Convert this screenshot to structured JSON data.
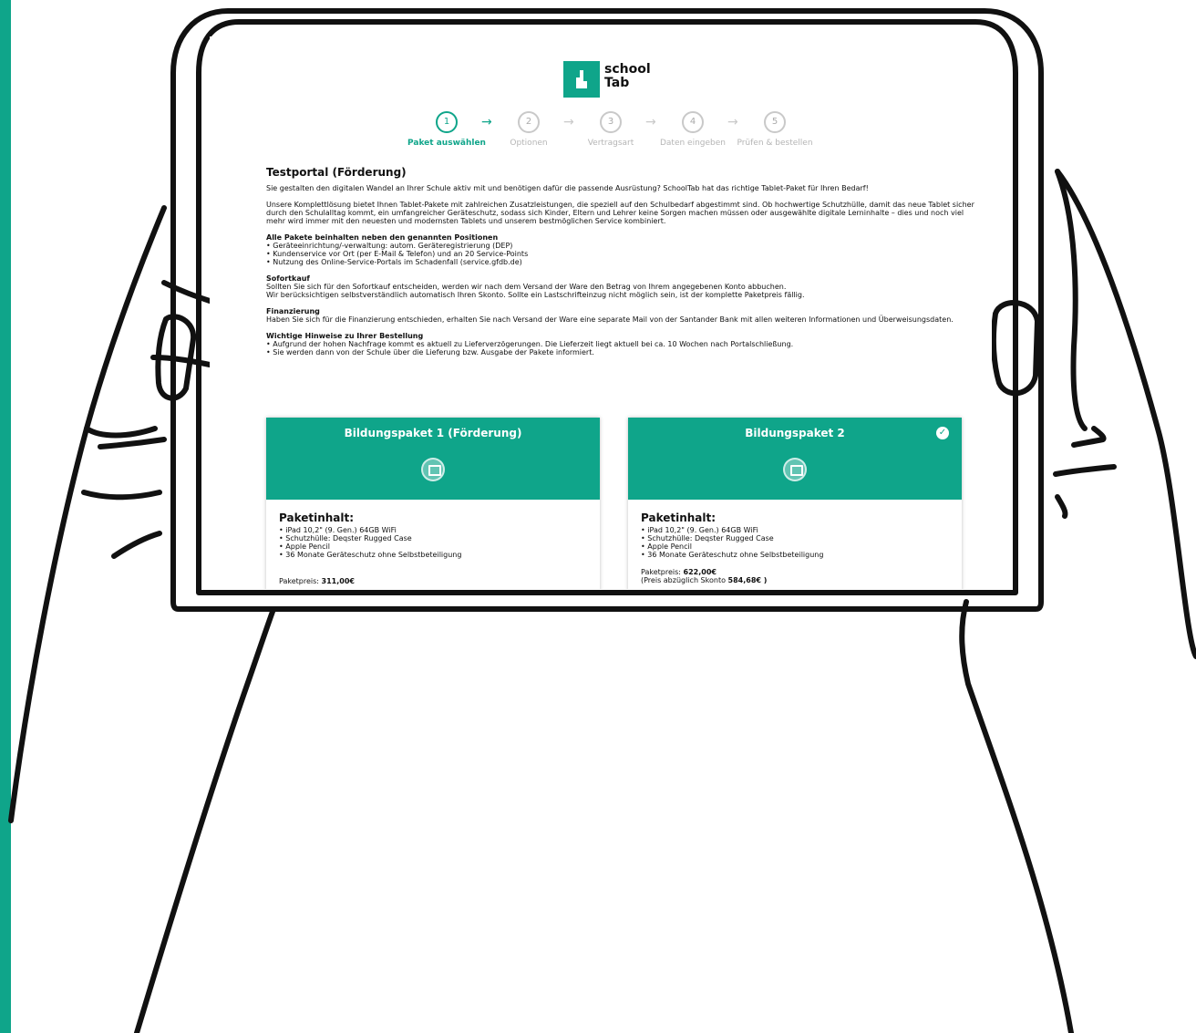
{
  "logo": {
    "line1": "school",
    "line2": "Tab"
  },
  "steps": [
    {
      "num": "1",
      "label": "Paket auswählen",
      "active": true
    },
    {
      "num": "2",
      "label": "Optionen",
      "active": false
    },
    {
      "num": "3",
      "label": "Vertragsart",
      "active": false
    },
    {
      "num": "4",
      "label": "Daten eingeben",
      "active": false
    },
    {
      "num": "5",
      "label": "Prüfen & bestellen",
      "active": false
    }
  ],
  "arrow_glyph": "→",
  "page": {
    "title": "Testportal (Förderung)",
    "intro": "Sie gestalten den digitalen Wandel an Ihrer Schule aktiv mit und benötigen dafür die passende Ausrüstung? SchoolTab hat das richtige Tablet-Paket für Ihren Bedarf!",
    "description": "Unsere Komplettlösung bietet Ihnen Tablet-Pakete mit zahlreichen Zusatzleistungen, die speziell auf den Schulbedarf abgestimmt sind. Ob hochwertige Schutzhülle, damit das neue Tablet sicher durch den Schulalltag kommt, ein umfangreicher Geräteschutz, sodass sich Kinder, Eltern und Lehrer keine Sorgen machen müssen oder ausgewählte digitale Lerninhalte – dies und noch viel mehr wird immer mit den neuesten und modernsten Tablets und unserem bestmöglichen Service kombiniert.",
    "sections": [
      {
        "heading": "Alle Pakete beinhalten neben den genannten Positionen",
        "lines": [
          "• Geräteeinrichtung/-verwaltung: autom. Geräteregistrierung (DEP)",
          "• Kundenservice vor Ort (per E-Mail & Telefon) und an 20 Service-Points",
          "• Nutzung des Online-Service-Portals im Schadenfall (service.gfdb.de)"
        ]
      },
      {
        "heading": "Sofortkauf",
        "lines": [
          "Sollten Sie sich für den Sofortkauf entscheiden, werden wir nach dem Versand der Ware den Betrag von Ihrem angegebenen Konto abbuchen.",
          "Wir berücksichtigen selbstverständlich automatisch Ihren Skonto. Sollte ein Lastschrifteinzug nicht möglich sein, ist der komplette Paketpreis fällig."
        ]
      },
      {
        "heading": "Finanzierung",
        "lines": [
          "Haben Sie sich für die Finanzierung entschieden, erhalten Sie nach Versand der Ware eine separate Mail von der Santander Bank mit allen weiteren Informationen und Überweisungsdaten."
        ]
      },
      {
        "heading": "Wichtige Hinweise zu Ihrer Bestellung",
        "lines": [
          "• Aufgrund der hohen Nachfrage kommt es aktuell zu Lieferverzögerungen. Die Lieferzeit liegt aktuell bei ca. 10 Wochen nach Portalschließung.",
          "• Sie werden dann von der Schule über die Lieferung bzw. Ausgabe der Pakete informiert."
        ]
      }
    ]
  },
  "packages": [
    {
      "title": "Bildungspaket 1 (Förderung)",
      "selected": false,
      "content_heading": "Paketinhalt:",
      "items": [
        "• iPad 10,2\" (9. Gen.) 64GB WiFi",
        "• Schutzhülle: Deqster Rugged Case",
        "• Apple Pencil",
        "• 36 Monate Geräteschutz ohne Selbstbeteiligung"
      ],
      "price_label": "Paketpreis:",
      "price_value": "311,00€",
      "skonto_label": "",
      "skonto_value": ""
    },
    {
      "title": "Bildungspaket 2",
      "selected": true,
      "check_glyph": "✓",
      "content_heading": "Paketinhalt:",
      "items": [
        "• iPad 10,2\" (9. Gen.) 64GB WiFi",
        "• Schutzhülle: Deqster Rugged Case",
        "• Apple Pencil",
        "• 36 Monate Geräteschutz ohne Selbstbeteiligung"
      ],
      "price_label": "Paketpreis:",
      "price_value": "622,00€",
      "skonto_label": "(Preis abzüglich Skonto",
      "skonto_value": "584,68€ )"
    }
  ],
  "colors": {
    "accent": "#0fa58a",
    "inactive": "#b5b5b5"
  }
}
